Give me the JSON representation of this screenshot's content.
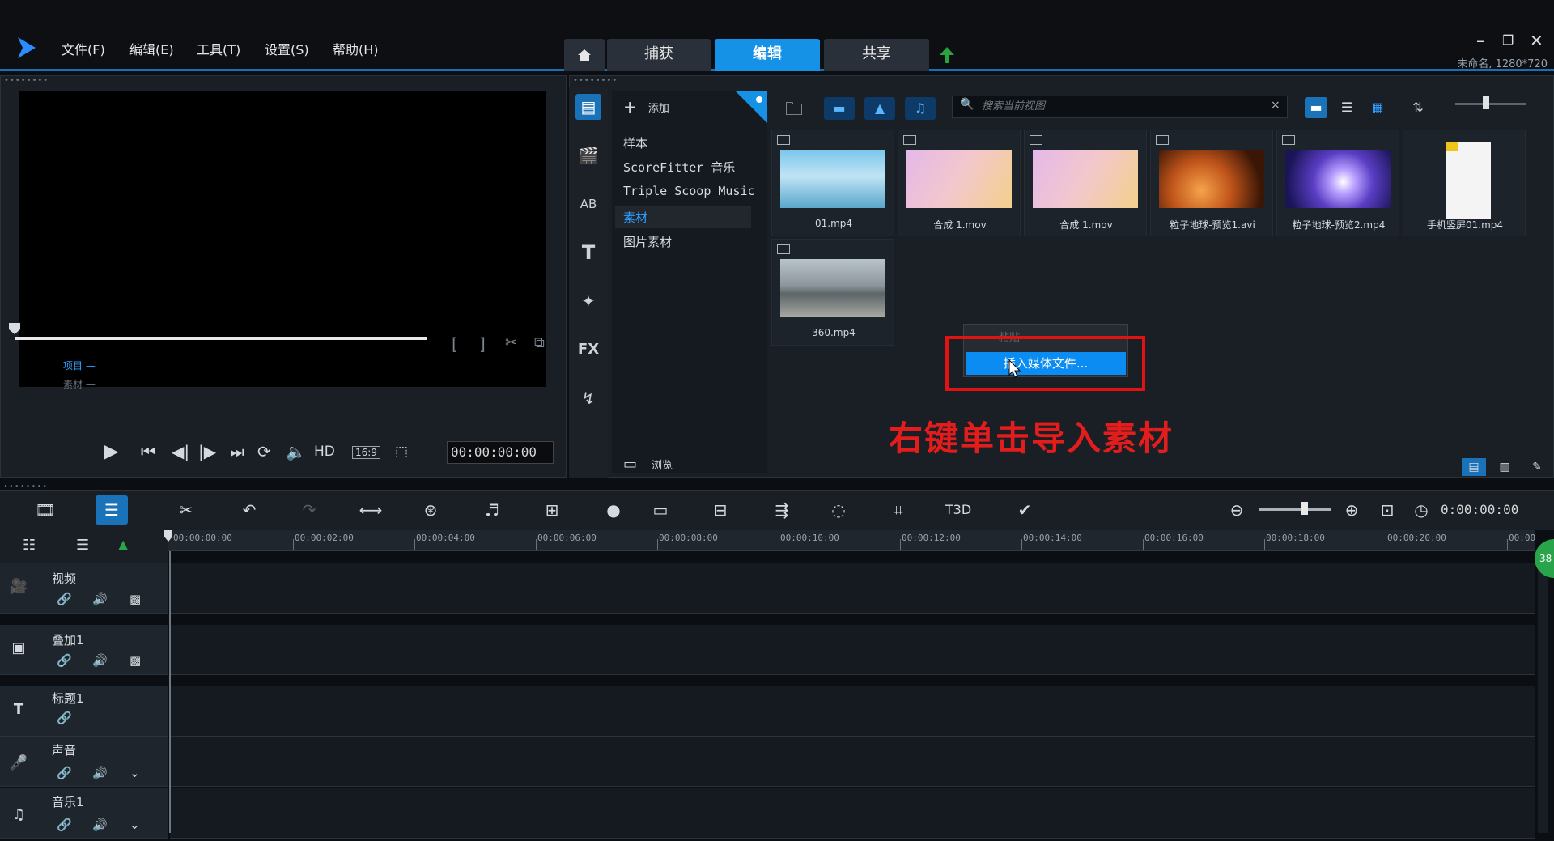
{
  "menu": {
    "file": "文件(F)",
    "edit": "编辑(E)",
    "tools": "工具(T)",
    "settings": "设置(S)",
    "help": "帮助(H)"
  },
  "main_tabs": {
    "capture": "捕获",
    "edit": "编辑",
    "share": "共享"
  },
  "project_info": "未命名, 1280*720",
  "preview": {
    "project_label": "项目 —",
    "clip_label": "素材 —",
    "hd_label": "HD",
    "aspect_label": "16:9",
    "timecode": "00:00:00:00"
  },
  "library": {
    "add_label": "添加",
    "folders": [
      "样本",
      "ScoreFitter 音乐",
      "Triple Scoop Music",
      "素材",
      "图片素材"
    ],
    "browse_label": "浏览",
    "search_placeholder": "搜索当前视图",
    "media": [
      {
        "name": "01.mp4"
      },
      {
        "name": "合成 1.mov"
      },
      {
        "name": "合成 1.mov"
      },
      {
        "name": "粒子地球-预览1.avi"
      },
      {
        "name": "粒子地球-预览2.mp4"
      },
      {
        "name": "手机竖屏01.mp4"
      },
      {
        "name": "360.mp4"
      }
    ]
  },
  "context_menu": {
    "paste": "粘贴",
    "insert_media": "插入媒体文件..."
  },
  "annotation": "右键单击导入素材",
  "timeline": {
    "timecode": "0:00:00:00",
    "ticks": [
      "00:00:00:00",
      "00:00:02:00",
      "00:00:04:00",
      "00:00:06:00",
      "00:00:08:00",
      "00:00:10:00",
      "00:00:12:00",
      "00:00:14:00",
      "00:00:16:00",
      "00:00:18:00",
      "00:00:20:00",
      "00:00"
    ],
    "tracks": {
      "video": "视频",
      "overlay": "叠加1",
      "title": "标题1",
      "voice": "声音",
      "music": "音乐1"
    },
    "badge": "38"
  },
  "colors": {
    "accent": "#1592e6",
    "annotation_red": "#e31c1c",
    "panel": "#1a1f26"
  }
}
